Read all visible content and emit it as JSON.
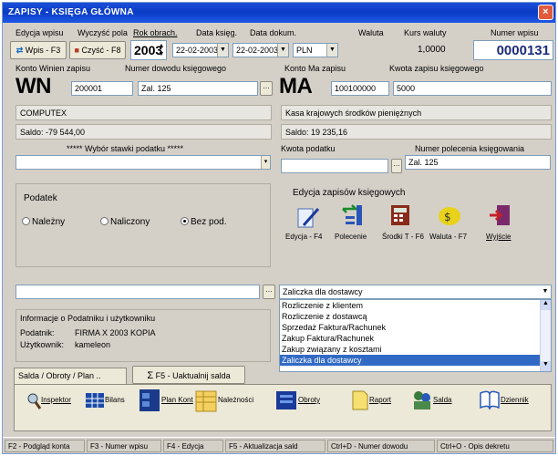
{
  "window": {
    "title": "ZAPISY - KSIĘGA GŁÓWNA",
    "close": "×"
  },
  "toolbar_labels": {
    "edycja_wpisu": "Edycja wpisu",
    "wyczysc_pola": "Wyczyść pola",
    "rok_obrach": "Rok obrach.",
    "data_ksieg": "Data księg.",
    "data_dokum": "Data dokum.",
    "waluta": "Waluta",
    "kurs_waluty": "Kurs waluty",
    "numer_wpisu": "Numer wpisu"
  },
  "toolbar": {
    "wpis_btn": "Wpis - F3",
    "czysc_btn": "Czyść - F8",
    "rok": "2003",
    "data_ksieg": "22-02-2003",
    "data_dokum": "22-02-2003",
    "waluta": "PLN",
    "kurs": "1,0000",
    "numer": "0000131"
  },
  "header_labels": {
    "konto_winien": "Konto  Winien  zapisu",
    "numer_dowodu": "Numer dowodu księgowego",
    "konto_ma": "Konto  Ma  zapisu",
    "kwota_zapisu": "Kwota zapisu księgowego"
  },
  "wn": {
    "label": "WN",
    "konto": "200001",
    "dowod": "Zal. 125",
    "name": "COMPUTEX",
    "saldo": "Saldo: -79 544,00"
  },
  "ma": {
    "label": "MA",
    "konto": "100100000",
    "kwota": "5000",
    "name": "Kasa krajowych środków pieniężnych",
    "saldo": "Saldo: 19 235,16"
  },
  "tax": {
    "stawka_label": "***** Wybór stawki podatku *****",
    "kwota_label": "Kwota podatku",
    "numer_polecenia_label": "Numer polecenia księgowania",
    "numer_polecenia": "Zal. 125"
  },
  "podatek": {
    "title": "Podatek",
    "options": [
      "Należny",
      "Naliczony",
      "Bez pod."
    ],
    "selected": 2
  },
  "edycja": {
    "title": "Edycja zapisów księgowych",
    "buttons": [
      "Edycja - F4",
      "Polecenie",
      "Środki T - F6",
      "Waluta - F7",
      "Wyjście"
    ]
  },
  "opis": {
    "selected": "Zaliczka dla dostawcy",
    "options": [
      "Rozliczenie  z klientem",
      "Rozliczenie  z dostawcą",
      "Sprzedaż Faktura/Rachunek",
      "Zakup Faktura/Rachunek",
      "Zakup związany z kosztami",
      "Zaliczka dla dostawcy"
    ]
  },
  "info": {
    "title": "Informacje o Podatniku i użytkowniku",
    "podatnik_label": "Podatnik:",
    "podatnik": "FIRMA X 2003  KOPIA",
    "uzytkownik_label": "Użytkownik:",
    "uzytkownik": "kameleon"
  },
  "tabs": {
    "salda": "Salda / Obroty / Plan ..",
    "uaktualnij": "F5 - Uaktualnij salda"
  },
  "bottom_toolbar": [
    "Inspektor",
    "Bilans",
    "Plan Kont",
    "Należności",
    "Obroty",
    "Raport",
    "Salda",
    "Dziennik"
  ],
  "status": [
    "F2 - Podgląd konta",
    "F3 - Numer wpisu",
    "F4 - Edycja",
    "F5 - Aktualizacja sald",
    "Ctrl+D - Numer dowodu",
    "Ctrl+O - Opis dekretu"
  ],
  "colors": {
    "titlebar": "#0a3bc4",
    "selection": "#316ac5",
    "window_bg": "#d4d0c8"
  }
}
